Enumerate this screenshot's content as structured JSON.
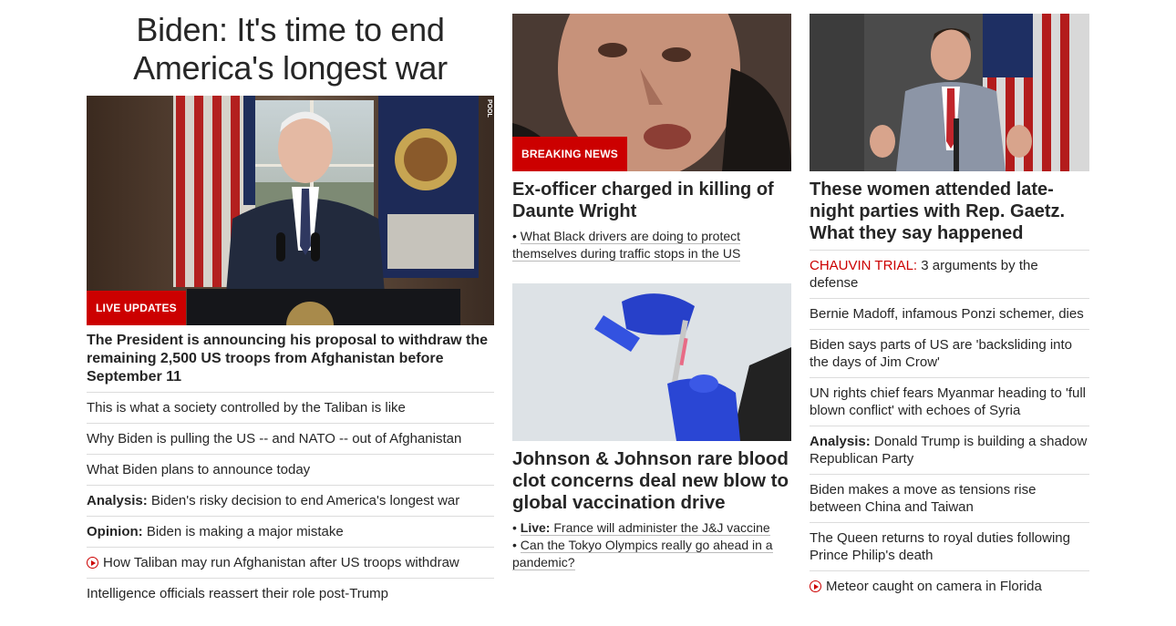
{
  "col1": {
    "title": "Biden: It's time to end America's longest war",
    "image_label": "LIVE UPDATES",
    "pool_tag": "POOL",
    "lead": "The President is announcing his proposal to withdraw the remaining 2,500 US troops from Afghanistan before September 11",
    "links": [
      {
        "prefix": "",
        "text": "This is what a society controlled by the Taliban is like",
        "video": false
      },
      {
        "prefix": "",
        "text": "Why Biden is pulling the US -- and NATO -- out of Afghanistan",
        "video": false
      },
      {
        "prefix": "",
        "text": "What Biden plans to announce today",
        "video": false
      },
      {
        "prefix": "Analysis:",
        "text": "Biden's risky decision to end America's longest war",
        "video": false
      },
      {
        "prefix": "Opinion:",
        "text": "Biden is making a major mistake",
        "video": false
      },
      {
        "prefix": "",
        "text": "How Taliban may run Afghanistan after US troops withdraw",
        "video": true
      },
      {
        "prefix": "",
        "text": "Intelligence officials reassert their role post-Trump",
        "video": false
      }
    ]
  },
  "col2": {
    "story1": {
      "image_label": "BREAKING NEWS",
      "headline": "Ex-officer charged in killing of Daunte Wright",
      "sub": "What Black drivers are doing to protect themselves during traffic stops in the US"
    },
    "story2": {
      "headline": "Johnson & Johnson rare blood clot concerns deal new blow to global vaccination drive",
      "sub1_prefix": "Live:",
      "sub1": "France will administer the J&J vaccine",
      "sub2": "Can the Tokyo Olympics really go ahead in a pandemic?"
    }
  },
  "col3": {
    "headline": "These women attended late-night parties with Rep. Gaetz. What they say happened",
    "links": [
      {
        "prefix": "CHAUVIN TRIAL:",
        "text": "3 arguments by the defense",
        "style": "red",
        "video": false
      },
      {
        "prefix": "",
        "text": "Bernie Madoff, infamous Ponzi schemer, dies",
        "style": "",
        "video": false
      },
      {
        "prefix": "",
        "text": "Biden says parts of US are 'backsliding into the days of Jim Crow'",
        "style": "",
        "video": false
      },
      {
        "prefix": "",
        "text": "UN rights chief fears Myanmar heading to 'full blown conflict' with echoes of Syria",
        "style": "",
        "video": false
      },
      {
        "prefix": "Analysis:",
        "text": "Donald Trump is building a shadow Republican Party",
        "style": "bold",
        "video": false
      },
      {
        "prefix": "",
        "text": "Biden makes a move as tensions rise between China and Taiwan",
        "style": "",
        "video": false
      },
      {
        "prefix": "",
        "text": "The Queen returns to royal duties following Prince Philip's death",
        "style": "",
        "video": false
      },
      {
        "prefix": "",
        "text": "Meteor caught on camera in Florida",
        "style": "",
        "video": true
      }
    ]
  },
  "colors": {
    "accent": "#cc0000",
    "text": "#262626",
    "divider": "#dcdcdc"
  }
}
